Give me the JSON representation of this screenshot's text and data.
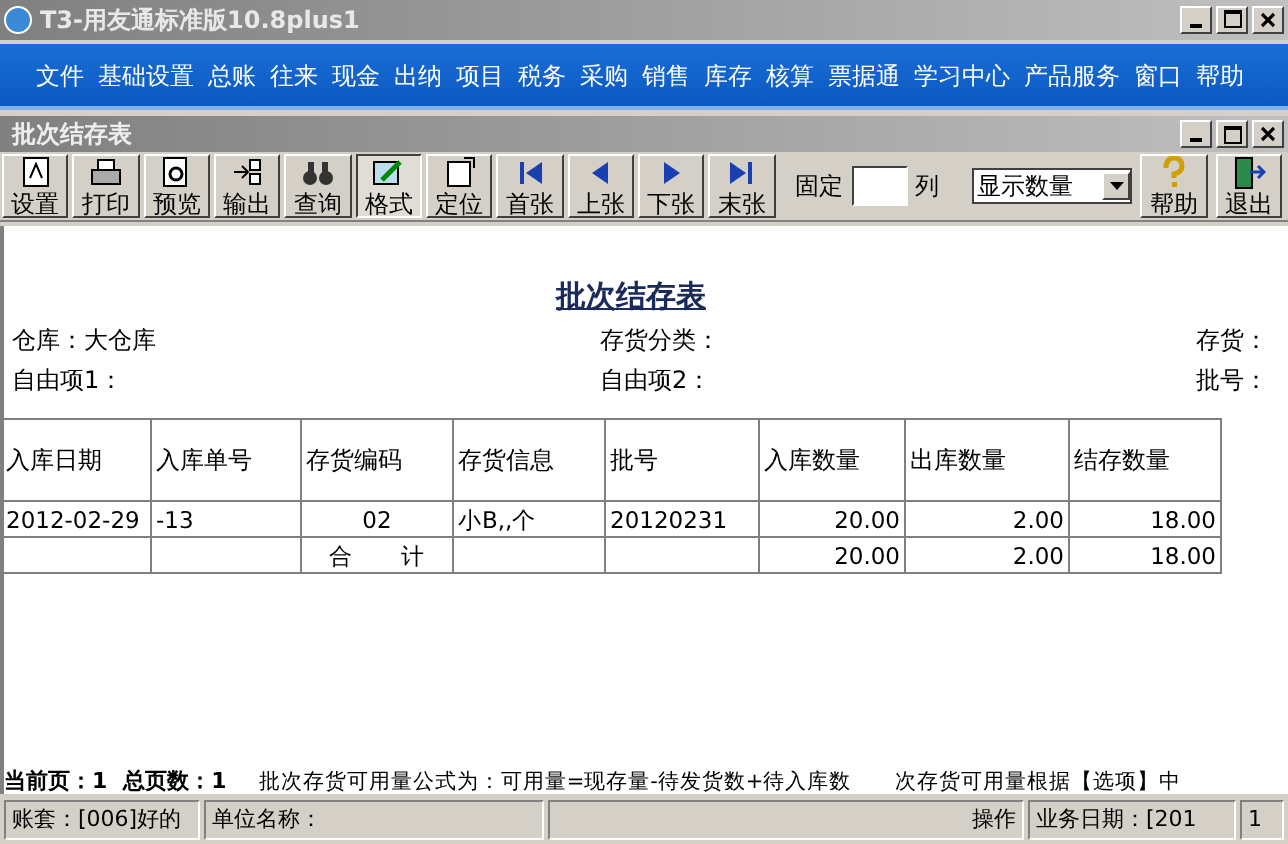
{
  "window": {
    "title": "T3-用友通标准版10.8plus1"
  },
  "menu": [
    "文件",
    "基础设置",
    "总账",
    "往来",
    "现金",
    "出纳",
    "项目",
    "税务",
    "采购",
    "销售",
    "库存",
    "核算",
    "票据通",
    "学习中心",
    "产品服务",
    "窗口",
    "帮助"
  ],
  "child_window": {
    "title": "批次结存表"
  },
  "toolbar": [
    {
      "label": "设置",
      "kind": "doc"
    },
    {
      "label": "打印",
      "kind": "print"
    },
    {
      "label": "预览",
      "kind": "preview"
    },
    {
      "label": "输出",
      "kind": "export"
    },
    {
      "label": "查询",
      "kind": "binoculars"
    },
    {
      "label": "格式",
      "kind": "format",
      "selected": true
    },
    {
      "label": "定位",
      "kind": "locate"
    },
    {
      "label": "首张",
      "kind": "first"
    },
    {
      "label": "上张",
      "kind": "prev"
    },
    {
      "label": "下张",
      "kind": "next"
    },
    {
      "label": "末张",
      "kind": "last"
    }
  ],
  "fix_columns": {
    "label": "固定",
    "unit": "列"
  },
  "display_select": {
    "value": "显示数量"
  },
  "right_buttons": [
    {
      "label": "帮助",
      "kind": "help"
    },
    {
      "label": "退出",
      "kind": "exit"
    }
  ],
  "report": {
    "title": "批次结存表",
    "filters": [
      [
        "仓库：大仓库",
        "存货分类：",
        "存货："
      ],
      [
        "自由项1：",
        "自由项2：",
        "批号："
      ]
    ],
    "columns": [
      "入库日期",
      "入库单号",
      "存货编码",
      "存货信息",
      "批号",
      "入库数量",
      "出库数量",
      "结存数量"
    ],
    "rows": [
      [
        "2012-02-29",
        "-13",
        "02",
        "小B,,个",
        "20120231",
        "20.00",
        "2.00",
        "18.00"
      ],
      [
        "",
        "",
        "合　　计",
        "",
        "",
        "20.00",
        "2.00",
        "18.00"
      ]
    ]
  },
  "footer": {
    "current_page": "当前页：1",
    "total_pages": "总页数：1",
    "formula": [
      "批次存货可用量公式为：可用量=现存量-待发货数+待入库数",
      "次存货可用量根据【选项】中"
    ]
  },
  "status_bar": [
    "账套：[006]好的",
    "单位名称：",
    "操作",
    "业务日期：[201",
    "1"
  ]
}
